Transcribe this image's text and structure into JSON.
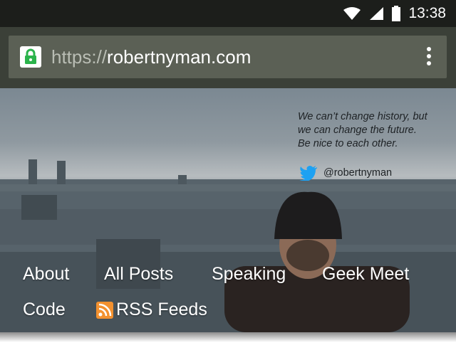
{
  "status_bar": {
    "time": "13:38",
    "icons": [
      "wifi-icon",
      "cell-signal-icon",
      "battery-icon"
    ]
  },
  "browser": {
    "url_scheme": "https://",
    "url_host": "robertnyman.com",
    "lock_color": "#2bb34b"
  },
  "hero": {
    "quote": [
      "We can’t change history, but",
      "we can change the future.",
      "Be nice to each other."
    ],
    "twitter_handle": "@robertnyman",
    "twitter_color": "#1da1f2"
  },
  "nav": {
    "items": [
      {
        "label": "About"
      },
      {
        "label": "All Posts"
      },
      {
        "label": "Speaking"
      },
      {
        "label": "Geek Meet"
      },
      {
        "label": "Code"
      },
      {
        "label": "RSS Feeds",
        "icon": "rss-icon"
      }
    ]
  }
}
